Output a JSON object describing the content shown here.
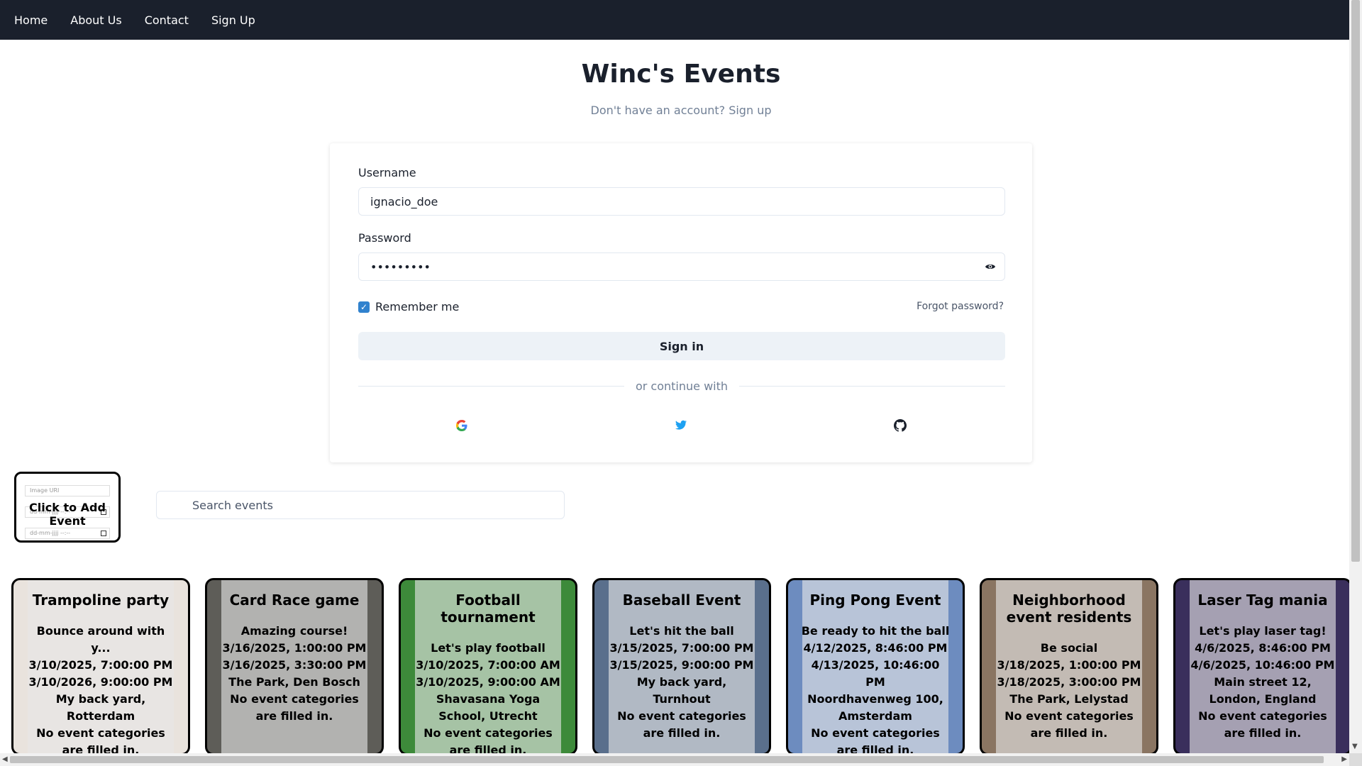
{
  "nav": {
    "items": [
      "Home",
      "About Us",
      "Contact",
      "Sign Up"
    ]
  },
  "header": {
    "title": "Winc's Events",
    "subtitle": "Don't have an account? Sign up"
  },
  "login": {
    "username_label": "Username",
    "username_value": "ignacio_doe",
    "password_label": "Password",
    "password_value": "•••••••••",
    "remember_label": "Remember me",
    "remember_checked": true,
    "forgot_label": "Forgot password?",
    "signin_label": "Sign in",
    "divider_label": "or continue with",
    "social": [
      "google-icon",
      "twitter-icon",
      "github-icon"
    ]
  },
  "add_event": {
    "image_placeholder": "Image URI",
    "date_placeholder": "dd-mm-jjjj --:--",
    "label": "Click to Add Event"
  },
  "search": {
    "placeholder": "Search events"
  },
  "events": [
    {
      "title": "Trampoline party",
      "description": "Bounce around with y...",
      "start": "3/10/2025, 7:00:00 PM",
      "end": "3/10/2026, 9:00:00 PM",
      "location": "My back yard, Rotterdam",
      "categories": "No event categories are filled in.",
      "bg": "#e9e3dd"
    },
    {
      "title": "Card Race game",
      "description": "Amazing course!",
      "start": "3/16/2025, 1:00:00 PM",
      "end": "3/16/2025, 3:30:00 PM",
      "location": "The Park, Den Bosch",
      "categories": "No event categories are filled in.",
      "bg": "#5e5d58"
    },
    {
      "title": "Football tournament",
      "description": "Let's play football",
      "start": "3/10/2025, 7:00:00 AM",
      "end": "3/10/2025, 9:00:00 AM",
      "location": "Shavasana Yoga School, Utrecht",
      "categories": "No event categories are filled in.",
      "bg": "#3d8a3a"
    },
    {
      "title": "Baseball Event",
      "description": "Let's hit the ball",
      "start": "3/15/2025, 7:00:00 PM",
      "end": "3/15/2025, 9:00:00 PM",
      "location": "My back yard, Turnhout",
      "categories": "No event categories are filled in.",
      "bg": "#5a6f8c"
    },
    {
      "title": "Ping Pong Event",
      "description": "Be ready to hit the ball",
      "start": "4/12/2025, 8:46:00 PM",
      "end": "4/13/2025, 10:46:00 PM",
      "location": "Noordhavenweg 100, Amsterdam",
      "categories": "No event categories are filled in.",
      "bg": "#6d8cbf"
    },
    {
      "title": "Neighborhood event residents",
      "description": "Be social",
      "start": "3/18/2025, 1:00:00 PM",
      "end": "3/18/2025, 3:00:00 PM",
      "location": "The Park, Lelystad",
      "categories": "No event categories are filled in.",
      "bg": "#8a7562"
    },
    {
      "title": "Laser Tag mania",
      "description": "Let's play laser tag!",
      "start": "4/6/2025, 8:46:00 PM",
      "end": "4/6/2025, 10:46:00 PM",
      "location": "Main street 12, London, England",
      "categories": "No event categories are filled in.",
      "bg": "#3a2f5c"
    }
  ]
}
